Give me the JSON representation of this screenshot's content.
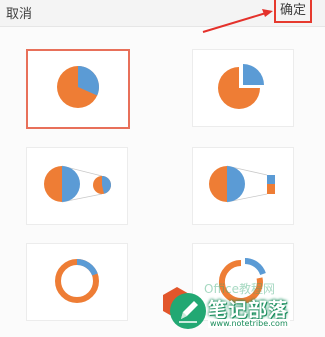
{
  "header": {
    "cancel_label": "取消",
    "confirm_label": "确定"
  },
  "colors": {
    "orange": "#ee7d35",
    "blue": "#5b9bd5",
    "selection": "#e8705a",
    "arrow": "#e4312b"
  },
  "chart_options": [
    {
      "id": "pie",
      "selected": true
    },
    {
      "id": "exploded-pie",
      "selected": false
    },
    {
      "id": "pie-of-pie",
      "selected": false
    },
    {
      "id": "bar-of-pie",
      "selected": false
    },
    {
      "id": "doughnut",
      "selected": false
    },
    {
      "id": "exploded-doughnut",
      "selected": false
    }
  ],
  "watermark": {
    "brand": "笔记部落",
    "url": "www.notetribe.com",
    "faint_text": "Office教程网"
  }
}
